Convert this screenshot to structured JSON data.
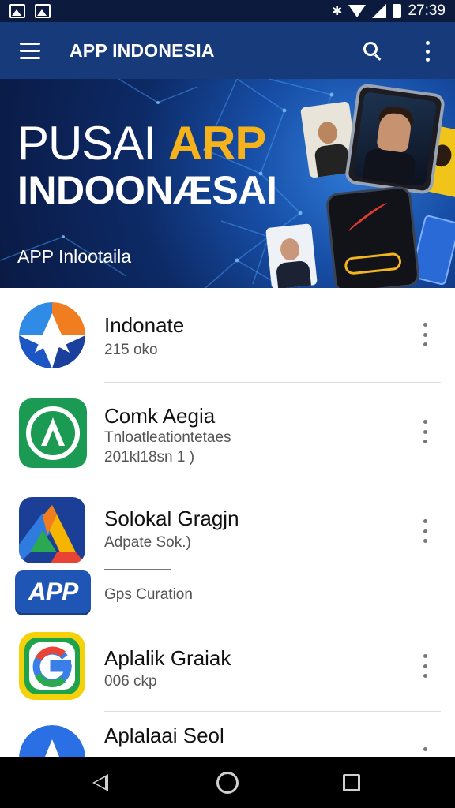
{
  "status_bar": {
    "time": "27:39",
    "bluetooth_glyph": "✱",
    "icons": [
      "gallery-icon",
      "gallery-icon",
      "bluetooth-icon",
      "wifi-icon",
      "signal-icon",
      "battery-icon"
    ]
  },
  "app_bar": {
    "title": "APP INDONESIA",
    "icons": [
      "menu-icon",
      "search-icon",
      "more-vert-icon"
    ]
  },
  "banner": {
    "line1_part1": "PUSAI ",
    "line1_part2": "ARP",
    "line2": "INDOONÆSAI",
    "subtitle": "APP Inlootaila",
    "accent_color": "#f6b21a"
  },
  "apps": [
    {
      "title": "Indonate",
      "lines": [
        "215 oko"
      ]
    },
    {
      "title": "Comk Aegia",
      "lines": [
        "Tnloatleationtetaes",
        "201kl18sn 1 )"
      ]
    },
    {
      "title": "Solokal Gragjn",
      "lines": [
        "Adpate Sok.)"
      ]
    },
    {
      "title": "Aplalik Graiak",
      "lines": [
        "006 ckp"
      ]
    },
    {
      "title": "Aplalaai Seol",
      "lines": []
    }
  ],
  "app_badge": {
    "label": "APP",
    "caption": "Gps Curation",
    "color": "#1f56b6"
  },
  "nav_bar": {
    "icons": [
      "back-icon",
      "home-icon",
      "recents-icon"
    ]
  },
  "colors": {
    "app_bar": "#173a7a",
    "status_bar": "#0b1a3d",
    "nav_bar": "#000000"
  }
}
